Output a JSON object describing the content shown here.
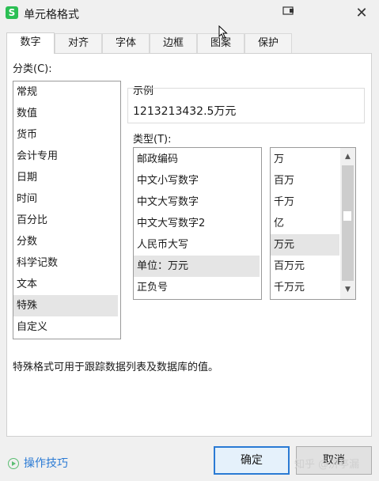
{
  "window": {
    "app_icon": "S",
    "title": "单元格格式"
  },
  "tabs": [
    {
      "label": "数字"
    },
    {
      "label": "对齐"
    },
    {
      "label": "字体"
    },
    {
      "label": "边框"
    },
    {
      "label": "图案"
    },
    {
      "label": "保护"
    }
  ],
  "category": {
    "label": "分类(C):",
    "items": [
      "常规",
      "数值",
      "货币",
      "会计专用",
      "日期",
      "时间",
      "百分比",
      "分数",
      "科学记数",
      "文本",
      "特殊",
      "自定义"
    ],
    "selected": "特殊"
  },
  "sample": {
    "label": "示例",
    "value": "1213213432.5万元"
  },
  "type": {
    "label": "类型(T):",
    "items": [
      "邮政编码",
      "中文小写数字",
      "中文大写数字",
      "中文大写数字2",
      "人民币大写",
      "单位：万元",
      "正负号"
    ],
    "selected": "单位：万元"
  },
  "unit": {
    "items": [
      "万",
      "百万",
      "千万",
      "亿",
      "万元",
      "百万元",
      "千万元"
    ],
    "selected": "万元"
  },
  "description": "特殊格式可用于跟踪数据列表及数据库的值。",
  "buttons": {
    "ok": "确定",
    "cancel": "取消"
  },
  "footer": {
    "tips": "操作技巧"
  },
  "watermark": "知乎 @济亭漏"
}
